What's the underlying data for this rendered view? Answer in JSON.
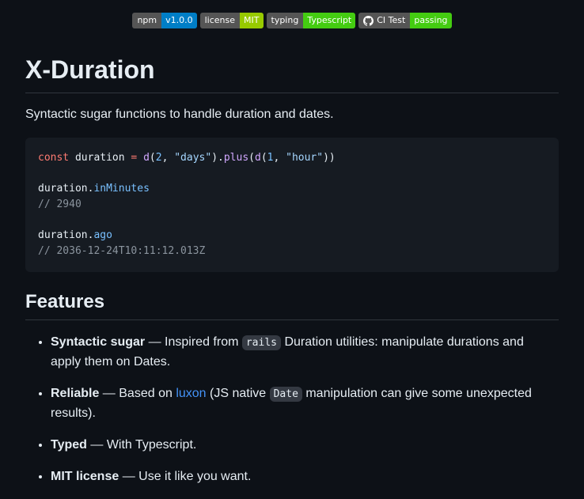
{
  "badges": [
    {
      "label": "npm",
      "value": "v1.0.0",
      "color": "#007ec6"
    },
    {
      "label": "license",
      "value": "MIT",
      "color": "#97ca00"
    },
    {
      "label": "typing",
      "value": "Typescript",
      "color": "#4c1"
    },
    {
      "label": "CI Test",
      "value": "passing",
      "color": "#4c1",
      "icon": "github-icon"
    }
  ],
  "title": "X-Duration",
  "lede": "Syntactic sugar functions to handle duration and dates.",
  "code": {
    "l1": {
      "kw": "const",
      "var": " duration ",
      "eq": "=",
      "sp": " ",
      "d1": "d",
      "p1": "(",
      "n1": "2",
      "c1": ", ",
      "s1": "\"days\"",
      "p2": ").",
      "plus": "plus",
      "p3": "(",
      "d2": "d",
      "p4": "(",
      "n2": "1",
      "c2": ", ",
      "s2": "\"hour\"",
      "p5": "))"
    },
    "l3": {
      "obj": "duration.",
      "prop": "inMinutes"
    },
    "l4": "// 2940",
    "l6": {
      "obj": "duration.",
      "prop": "ago"
    },
    "l7": "// 2036-12-24T10:11:12.013Z"
  },
  "features_heading": "Features",
  "features": [
    {
      "title": "Syntactic sugar",
      "t1": " — Inspired from ",
      "code": "rails",
      "t2": " Duration utilities: manipulate durations and apply them on Dates."
    },
    {
      "title": "Reliable",
      "t1": " — Based on ",
      "link": "luxon",
      "t2": " (JS native ",
      "code": "Date",
      "t3": " manipulation can give some unexpected results)."
    },
    {
      "title": "Typed",
      "t1": " — With Typescript."
    },
    {
      "title": "MIT license",
      "t1": " — Use it like you want."
    }
  ]
}
